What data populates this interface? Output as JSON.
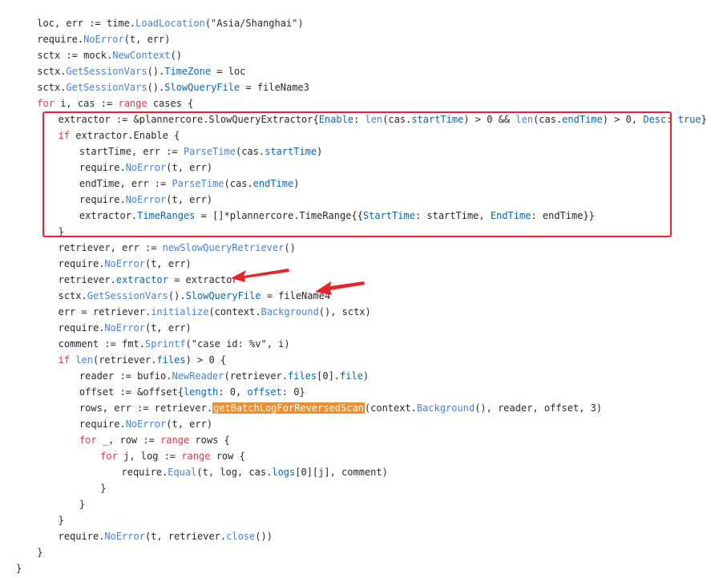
{
  "colors": {
    "background": "#ffffff",
    "plain": "#24292e",
    "keyword": "#d73a49",
    "function": "#4a7fd6",
    "field": "#0b64b8",
    "annotation": "#e8242a",
    "highlight": "#f28c28"
  },
  "annotations": {
    "box": {
      "color": "#e8242a"
    },
    "arrows": [
      {
        "name": "arrow-to-retriever-extractor",
        "color": "#e8242a"
      },
      {
        "name": "arrow-to-slowqueryfile",
        "color": "#e8242a"
      }
    ]
  },
  "code_lines": [
    {
      "indent": 1,
      "tokens": [
        [
          "plain",
          "loc, err := time."
        ],
        [
          "func",
          "LoadLocation"
        ],
        [
          "plain",
          "(\"Asia/Shanghai\")"
        ]
      ]
    },
    {
      "indent": 1,
      "tokens": [
        [
          "plain",
          "require."
        ],
        [
          "func",
          "NoError"
        ],
        [
          "plain",
          "(t, err)"
        ]
      ]
    },
    {
      "indent": 1,
      "tokens": [
        [
          "plain",
          "sctx := mock."
        ],
        [
          "func",
          "NewContext"
        ],
        [
          "plain",
          "()"
        ]
      ]
    },
    {
      "indent": 1,
      "tokens": [
        [
          "plain",
          "sctx."
        ],
        [
          "func",
          "GetSessionVars"
        ],
        [
          "plain",
          "()."
        ],
        [
          "field",
          "TimeZone"
        ],
        [
          "plain",
          " = loc"
        ]
      ]
    },
    {
      "indent": 1,
      "tokens": [
        [
          "plain",
          "sctx."
        ],
        [
          "func",
          "GetSessionVars"
        ],
        [
          "plain",
          "()."
        ],
        [
          "field",
          "SlowQueryFile"
        ],
        [
          "plain",
          " = fileName3"
        ]
      ]
    },
    {
      "indent": 1,
      "tokens": [
        [
          "keyword",
          "for"
        ],
        [
          "plain",
          " i, cas := "
        ],
        [
          "keyword",
          "range"
        ],
        [
          "plain",
          " cases {"
        ]
      ]
    },
    {
      "indent": 2,
      "tokens": [
        [
          "plain",
          "extractor := &plannercore.SlowQueryExtractor{"
        ],
        [
          "field",
          "Enable"
        ],
        [
          "plain",
          ": "
        ],
        [
          "func",
          "len"
        ],
        [
          "plain",
          "(cas."
        ],
        [
          "field",
          "startTime"
        ],
        [
          "plain",
          ") > 0 && "
        ],
        [
          "func",
          "len"
        ],
        [
          "plain",
          "(cas."
        ],
        [
          "field",
          "endTime"
        ],
        [
          "plain",
          ") > 0, "
        ],
        [
          "field",
          "Desc"
        ],
        [
          "plain",
          ": "
        ],
        [
          "field",
          "true"
        ],
        [
          "plain",
          "}"
        ]
      ]
    },
    {
      "indent": 2,
      "tokens": [
        [
          "keyword",
          "if"
        ],
        [
          "plain",
          " extractor.Enable {"
        ]
      ]
    },
    {
      "indent": 3,
      "tokens": [
        [
          "plain",
          "startTime, err := "
        ],
        [
          "func",
          "ParseTime"
        ],
        [
          "plain",
          "(cas."
        ],
        [
          "field",
          "startTime"
        ],
        [
          "plain",
          ")"
        ]
      ]
    },
    {
      "indent": 3,
      "tokens": [
        [
          "plain",
          "require."
        ],
        [
          "func",
          "NoError"
        ],
        [
          "plain",
          "(t, err)"
        ]
      ]
    },
    {
      "indent": 3,
      "tokens": [
        [
          "plain",
          "endTime, err := "
        ],
        [
          "func",
          "ParseTime"
        ],
        [
          "plain",
          "(cas."
        ],
        [
          "field",
          "endTime"
        ],
        [
          "plain",
          ")"
        ]
      ]
    },
    {
      "indent": 3,
      "tokens": [
        [
          "plain",
          "require."
        ],
        [
          "func",
          "NoError"
        ],
        [
          "plain",
          "(t, err)"
        ]
      ]
    },
    {
      "indent": 3,
      "tokens": [
        [
          "plain",
          "extractor."
        ],
        [
          "field",
          "TimeRanges"
        ],
        [
          "plain",
          " = []*plannercore.TimeRange{{"
        ],
        [
          "field",
          "StartTime"
        ],
        [
          "plain",
          ": startTime, "
        ],
        [
          "field",
          "EndTime"
        ],
        [
          "plain",
          ": endTime}}"
        ]
      ]
    },
    {
      "indent": 2,
      "tokens": [
        [
          "plain",
          "}"
        ]
      ]
    },
    {
      "indent": 2,
      "tokens": [
        [
          "plain",
          "retriever, err := "
        ],
        [
          "func",
          "newSlowQueryRetriever"
        ],
        [
          "plain",
          "()"
        ]
      ]
    },
    {
      "indent": 2,
      "tokens": [
        [
          "plain",
          "require."
        ],
        [
          "func",
          "NoError"
        ],
        [
          "plain",
          "(t, err)"
        ]
      ]
    },
    {
      "indent": 2,
      "tokens": [
        [
          "plain",
          "retriever."
        ],
        [
          "field",
          "extractor"
        ],
        [
          "plain",
          " = extractor"
        ]
      ]
    },
    {
      "indent": 2,
      "tokens": [
        [
          "plain",
          "sctx."
        ],
        [
          "func",
          "GetSessionVars"
        ],
        [
          "plain",
          "()."
        ],
        [
          "field",
          "SlowQueryFile"
        ],
        [
          "plain",
          " = fileName4"
        ]
      ]
    },
    {
      "indent": 2,
      "tokens": [
        [
          "plain",
          "err = retriever."
        ],
        [
          "func",
          "initialize"
        ],
        [
          "plain",
          "(context."
        ],
        [
          "func",
          "Background"
        ],
        [
          "plain",
          "(), sctx)"
        ]
      ]
    },
    {
      "indent": 2,
      "tokens": [
        [
          "plain",
          "require."
        ],
        [
          "func",
          "NoError"
        ],
        [
          "plain",
          "(t, err)"
        ]
      ]
    },
    {
      "indent": 2,
      "tokens": [
        [
          "plain",
          "comment := fmt."
        ],
        [
          "func",
          "Sprintf"
        ],
        [
          "plain",
          "(\"case id: %v\", i)"
        ]
      ]
    },
    {
      "indent": 2,
      "tokens": [
        [
          "keyword",
          "if"
        ],
        [
          "plain",
          " "
        ],
        [
          "func",
          "len"
        ],
        [
          "plain",
          "(retriever."
        ],
        [
          "field",
          "files"
        ],
        [
          "plain",
          ") > 0 {"
        ]
      ]
    },
    {
      "indent": 3,
      "tokens": [
        [
          "plain",
          "reader := bufio."
        ],
        [
          "func",
          "NewReader"
        ],
        [
          "plain",
          "(retriever."
        ],
        [
          "field",
          "files"
        ],
        [
          "plain",
          "[0]."
        ],
        [
          "field",
          "file"
        ],
        [
          "plain",
          ")"
        ]
      ]
    },
    {
      "indent": 3,
      "tokens": [
        [
          "plain",
          "offset := &offset{"
        ],
        [
          "field",
          "length"
        ],
        [
          "plain",
          ": 0, "
        ],
        [
          "field",
          "offset"
        ],
        [
          "plain",
          ": 0}"
        ]
      ]
    },
    {
      "indent": 3,
      "tokens": [
        [
          "plain",
          "rows, err := retriever."
        ],
        [
          "highlight",
          "getBatchLogForReversedScan"
        ],
        [
          "plain",
          "(context."
        ],
        [
          "func",
          "Background"
        ],
        [
          "plain",
          "(), reader, offset, 3)"
        ]
      ]
    },
    {
      "indent": 3,
      "tokens": [
        [
          "plain",
          "require."
        ],
        [
          "func",
          "NoError"
        ],
        [
          "plain",
          "(t, err)"
        ]
      ]
    },
    {
      "indent": 3,
      "tokens": [
        [
          "keyword",
          "for"
        ],
        [
          "plain",
          " _, row := "
        ],
        [
          "keyword",
          "range"
        ],
        [
          "plain",
          " rows {"
        ]
      ]
    },
    {
      "indent": 4,
      "tokens": [
        [
          "keyword",
          "for"
        ],
        [
          "plain",
          " j, log := "
        ],
        [
          "keyword",
          "range"
        ],
        [
          "plain",
          " row {"
        ]
      ]
    },
    {
      "indent": 5,
      "tokens": [
        [
          "plain",
          "require."
        ],
        [
          "func",
          "Equal"
        ],
        [
          "plain",
          "(t, log, cas."
        ],
        [
          "field",
          "logs"
        ],
        [
          "plain",
          "[0][j], comment)"
        ]
      ]
    },
    {
      "indent": 4,
      "tokens": [
        [
          "plain",
          "}"
        ]
      ]
    },
    {
      "indent": 3,
      "tokens": [
        [
          "plain",
          "}"
        ]
      ]
    },
    {
      "indent": 2,
      "tokens": [
        [
          "plain",
          "}"
        ]
      ]
    },
    {
      "indent": 2,
      "tokens": [
        [
          "plain",
          "require."
        ],
        [
          "func",
          "NoError"
        ],
        [
          "plain",
          "(t, retriever."
        ],
        [
          "func",
          "close"
        ],
        [
          "plain",
          "())"
        ]
      ]
    },
    {
      "indent": 1,
      "tokens": [
        [
          "plain",
          "}"
        ]
      ]
    },
    {
      "indent": 0,
      "tokens": [
        [
          "plain",
          "}"
        ]
      ]
    }
  ]
}
